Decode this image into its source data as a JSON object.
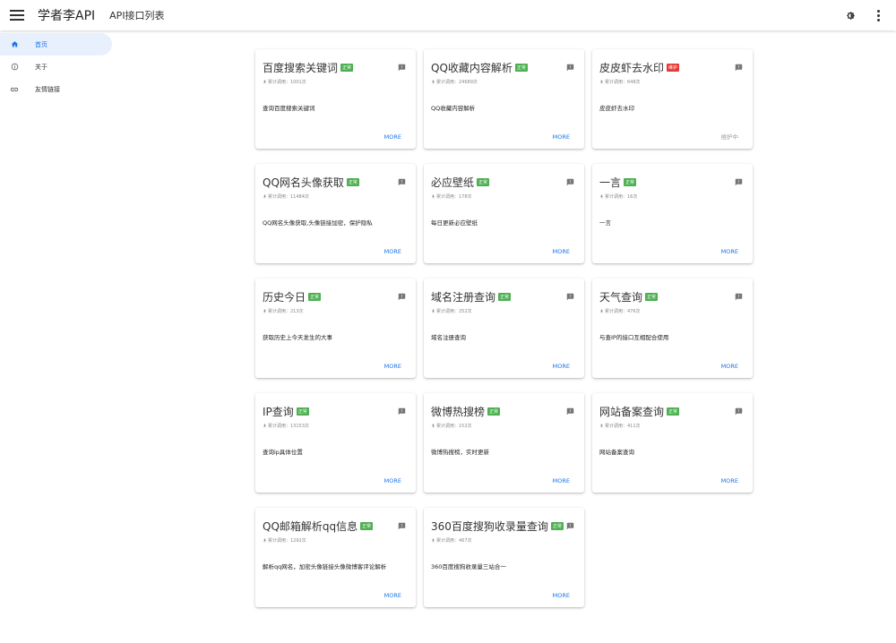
{
  "app": {
    "title": "学者李API",
    "subtitle": "API接口列表"
  },
  "icons": {
    "menu": "menu-icon",
    "theme": "brightness-icon",
    "more": "more-vert-icon",
    "feedback": "feedback-icon",
    "stat": "download-icon"
  },
  "colors": {
    "accent": "#1a73e8",
    "ok_badge": "#4caf50",
    "maint_badge": "#e53935",
    "nav_active_bg": "#e8f0fe"
  },
  "sidebar": {
    "items": [
      {
        "label": "首页",
        "icon": "home-icon",
        "active": true
      },
      {
        "label": "关于",
        "icon": "info-icon",
        "active": false
      },
      {
        "label": "友情链接",
        "icon": "link-icon",
        "active": false
      }
    ]
  },
  "cards": [
    {
      "title": "百度搜索关键词",
      "status": "正常",
      "stat": "累计调用：1001次",
      "desc": "查询百度搜索关键词",
      "action": "MORE"
    },
    {
      "title": "QQ收藏内容解析",
      "status": "正常",
      "stat": "累计调用：24689次",
      "desc": "QQ收藏内容解析",
      "action": "MORE"
    },
    {
      "title": "皮皮虾去水印",
      "status": "维护",
      "stat": "累计调用：648次",
      "desc": "皮皮虾去水印",
      "action": "维护中"
    },
    {
      "title": "QQ网名头像获取",
      "status": "正常",
      "stat": "累计调用：11484次",
      "desc": "QQ网名头像获取,头像链接加密，保护隐私",
      "action": "MORE"
    },
    {
      "title": "必应壁纸",
      "status": "正常",
      "stat": "累计调用：178次",
      "desc": "每日更新必应壁纸",
      "action": "MORE"
    },
    {
      "title": "一言",
      "status": "正常",
      "stat": "累计调用：16次",
      "desc": "一言",
      "action": "MORE"
    },
    {
      "title": "历史今日",
      "status": "正常",
      "stat": "累计调用：213次",
      "desc": "获取历史上今天发生的大事",
      "action": "MORE"
    },
    {
      "title": "域名注册查询",
      "status": "正常",
      "stat": "累计调用：252次",
      "desc": "域名注册查询",
      "action": "MORE"
    },
    {
      "title": "天气查询",
      "status": "正常",
      "stat": "累计调用：476次",
      "desc": "与查IP的接口互相配合使用",
      "action": "MORE"
    },
    {
      "title": "IP查询",
      "status": "正常",
      "stat": "累计调用：13153次",
      "desc": "查询ip具体位置",
      "action": "MORE"
    },
    {
      "title": "微博热搜榜",
      "status": "正常",
      "stat": "累计调用：152次",
      "desc": "微博热搜榜，实时更新",
      "action": "MORE"
    },
    {
      "title": "网站备案查询",
      "status": "正常",
      "stat": "累计调用：411次",
      "desc": "网站备案查询",
      "action": "MORE"
    },
    {
      "title": "QQ邮箱解析qq信息",
      "status": "正常",
      "stat": "累计调用：1292次",
      "desc": "解析qq网名，加密头像链接头像微博客评论解析",
      "action": "MORE"
    },
    {
      "title": "360百度搜狗收录量查询",
      "status": "正常",
      "stat": "累计调用：467次",
      "desc": "360百度搜狗收录量三站合一",
      "action": "MORE"
    }
  ]
}
